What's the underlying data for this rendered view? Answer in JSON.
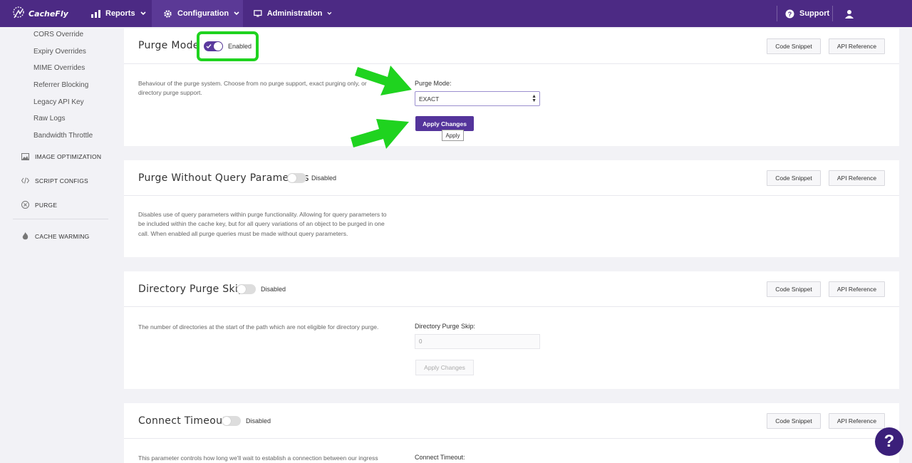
{
  "nav": {
    "logo_text": "CacheFly",
    "reports": "Reports",
    "configuration": "Configuration",
    "administration": "Administration",
    "support": "Support"
  },
  "sidebar": {
    "links": [
      "CORS Override",
      "Expiry Overrides",
      "MIME Overrides",
      "Referrer Blocking",
      "Legacy API Key",
      "Raw Logs",
      "Bandwidth Throttle"
    ],
    "sections": [
      "IMAGE OPTIMIZATION",
      "SCRIPT CONFIGS",
      "PURGE",
      "CACHE WARMING"
    ]
  },
  "common": {
    "code_snippet": "Code Snippet",
    "api_reference": "API Reference",
    "apply_changes": "Apply Changes"
  },
  "cards": {
    "purge_mode": {
      "title": "Purge Mode",
      "toggle_state": "Enabled",
      "desc": "Behaviour of the purge system. Choose from no purge support, exact purging only, or",
      "desc2": "directory purge support.",
      "field_label": "Purge Mode:",
      "select_value": "EXACT",
      "tooltip": "Apply"
    },
    "purge_without_query": {
      "title": "Purge Without Query Parameters",
      "toggle_state": "Disabled",
      "desc1": "Disables use of query parameters within purge functionality. Allowing for query parameters to",
      "desc2": "be included within the cache key, but for all query variations of an object to be purged in one",
      "desc3": "call. When enabled all purge queries must be made without query parameters."
    },
    "directory_purge_skip": {
      "title": "Directory Purge Skip",
      "toggle_state": "Disabled",
      "desc": "The number of directories at the start of the path which are not eligible for directory purge.",
      "field_label": "Directory Purge Skip:",
      "input_value": "0"
    },
    "connect_timeout": {
      "title": "Connect Timeout",
      "toggle_state": "Disabled",
      "desc": "This parameter controls how long we'll wait to establish a connection between our ingress",
      "field_label": "Connect Timeout:"
    }
  },
  "help": "?",
  "colors": {
    "brand": "#4c2a84",
    "primary_button": "#54349b",
    "annotation": "#1fd31f"
  }
}
